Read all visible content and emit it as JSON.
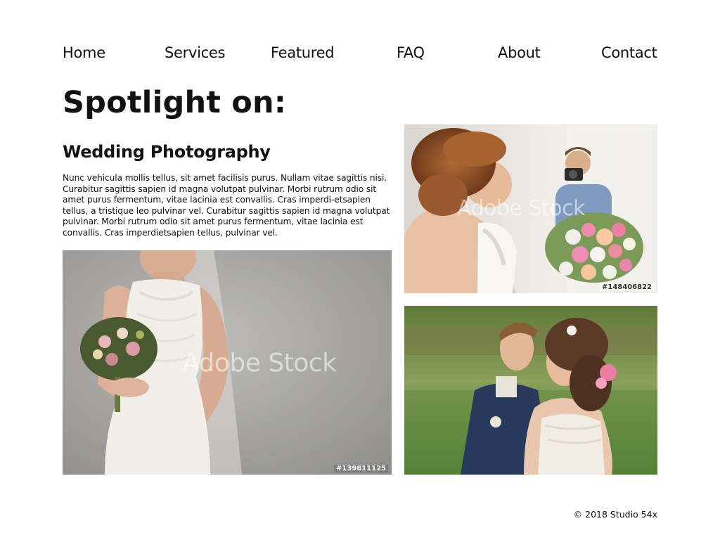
{
  "nav": {
    "items": [
      "Home",
      "Services",
      "Featured",
      "FAQ",
      "About",
      "Contact"
    ]
  },
  "hero": {
    "title": "Spotlight on:",
    "subtitle": "Wedding Photography",
    "body": "Nunc vehicula mollis tellus, sit amet facilisis purus. Nullam vitae sagittis nisi. Curabitur sagittis sapien id magna volutpat pulvinar. Morbi rutrum odio sit amet purus fermentum, vitae lacinia est convallis. Cras imperdi-etsapien tellus, a tristique leo pulvinar vel. Curabitur sagittis sapien id magna volutpat pulvinar. Morbi rutrum odio sit amet purus fermentum, vitae lacinia est convallis. Cras imperdietsapien tellus, pulvinar vel."
  },
  "photos": [
    {
      "watermark": "Adobe Stock",
      "stock_id": "#148406822"
    },
    {
      "watermark": "Adobe Stock",
      "stock_id": "#139811125"
    },
    {
      "watermark": "",
      "stock_id": ""
    }
  ],
  "footer": {
    "copyright": "© 2018 Studio 54x"
  }
}
